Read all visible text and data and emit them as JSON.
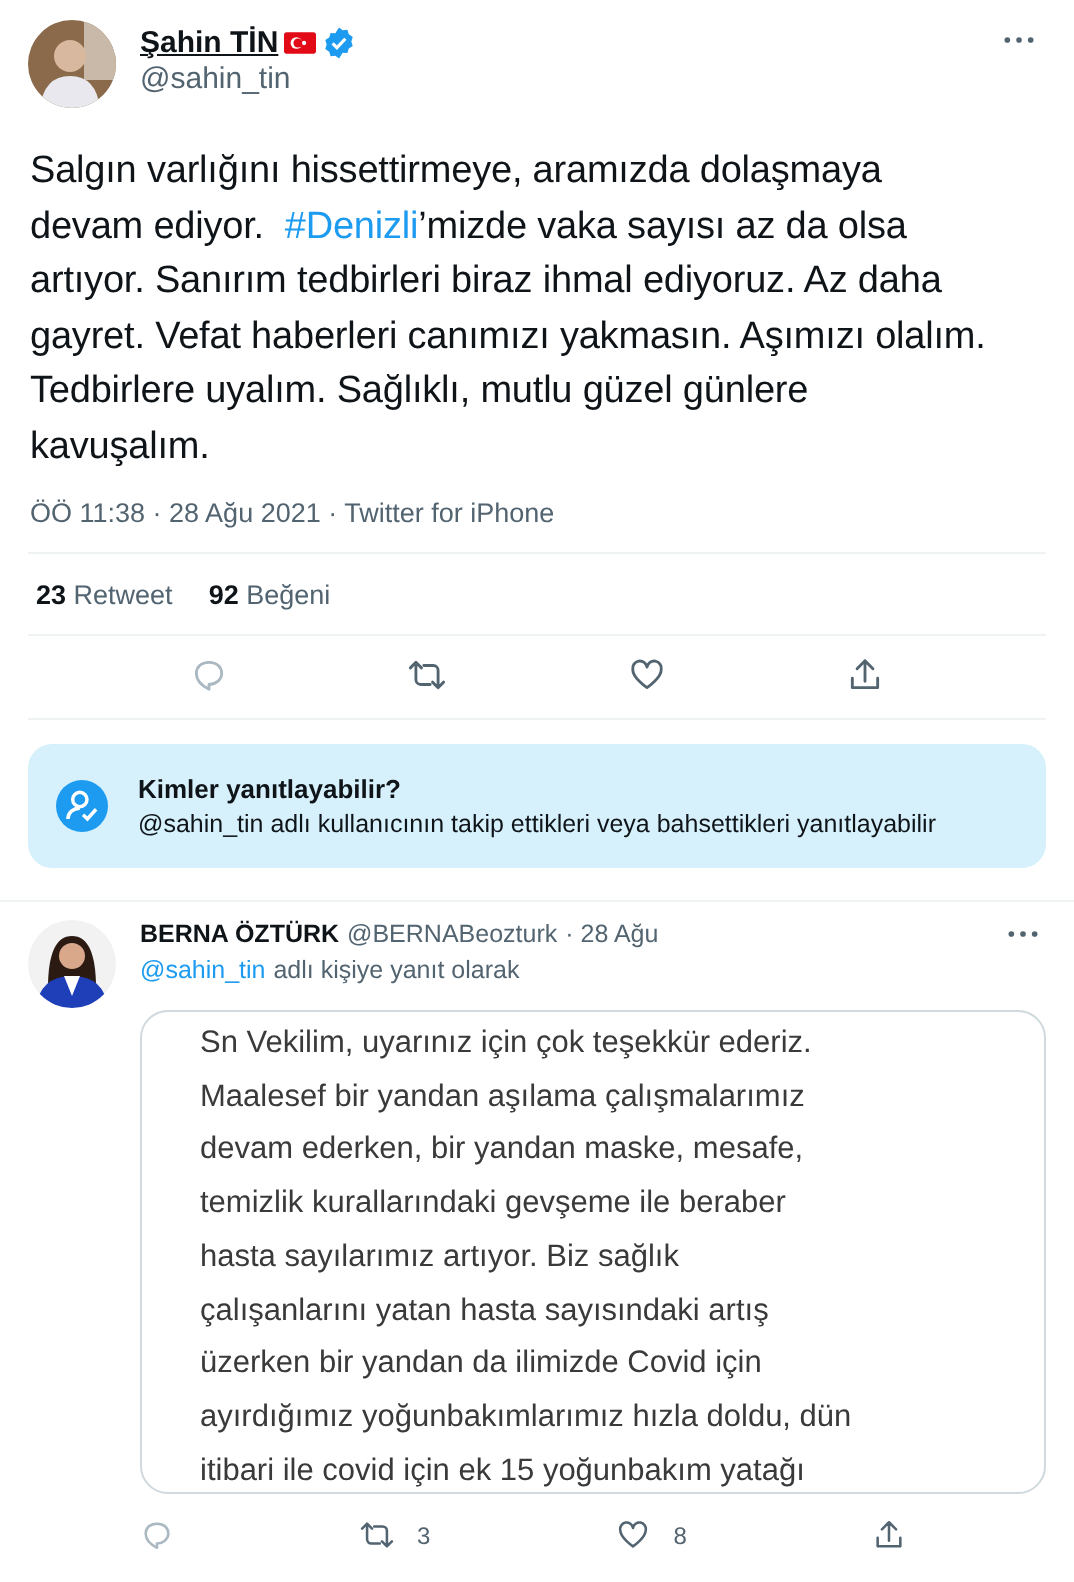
{
  "tweet": {
    "author": {
      "name": "Şahin TİN",
      "handle": "@sahin_tin",
      "verified": true
    },
    "hashtag": "#Denizli",
    "text_before": "Salgın varlığını hissettirmeye, aramızda dolaşmaya devam ediyor.  ",
    "text_after": "’mizde vaka sayısı az da olsa artıyor. Sanırım tedbirleri biraz ihmal ediyoruz. Az daha gayret. Vefat haberleri canımızı yakmasın. Aşımızı olalım. Tedbirlere uyalım. Sağlıklı, mutlu güzel günlere kavuşalım.",
    "meta": "ÖÖ 11:38 · 28 Ağu 2021 · Twitter for iPhone",
    "stats": [
      {
        "count": "23",
        "label": "Retweet"
      },
      {
        "count": "92",
        "label": "Beğeni"
      }
    ]
  },
  "reply_notice": {
    "title": "Kimler yanıtlayabilir?",
    "text": "@sahin_tin adlı kullanıcının takip ettikleri veya bahsettikleri yanıtlayabilir"
  },
  "reply": {
    "name": "BERNA ÖZTÜRK",
    "handle": "@BERNABeozturk",
    "date": "· 28 Ağu",
    "mention": "@sahin_tin",
    "replying_text": "adlı kişiye yanıt olarak",
    "image_lines": [
      "Sn Vekilim, uyarınız için çok teşekkür ederiz.",
      "Maalesef bir yandan aşılama çalışmalarımız",
      "devam ederken, bir yandan maske, mesafe,",
      "temizlik kurallarındaki gevşeme ile beraber",
      "hasta sayılarımız artıyor. Biz sağlık",
      "çalışanlarını yatan hasta sayısındaki artış",
      "üzerken bir yandan da ilimizde Covid için",
      "ayırdığımız yoğunbakımlarımız hızla doldu, dün",
      "itibari ile covid için ek 15 yoğunbakım yatağı"
    ],
    "retweets": "3",
    "likes": "8"
  }
}
